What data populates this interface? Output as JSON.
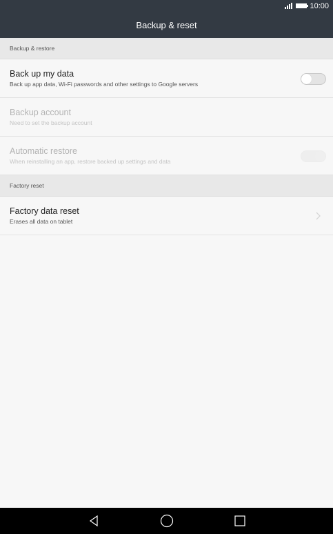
{
  "status_bar": {
    "time": "10:00",
    "signal_icon": "signal-icon",
    "battery_icon": "battery-icon"
  },
  "header": {
    "title": "Backup & reset"
  },
  "sections": [
    {
      "label": "Backup & restore",
      "items": [
        {
          "title": "Back up my data",
          "subtitle": "Back up app data, Wi-Fi passwords and other settings to Google servers",
          "control": "toggle",
          "toggle_on": false,
          "enabled": true
        },
        {
          "title": "Backup account",
          "subtitle": "Need to set the backup account",
          "control": "none",
          "enabled": false
        },
        {
          "title": "Automatic restore",
          "subtitle": "When reinstalling an app, restore backed up settings and data",
          "control": "toggle",
          "toggle_on": true,
          "enabled": false
        }
      ]
    },
    {
      "label": "Factory reset",
      "items": [
        {
          "title": "Factory data reset",
          "subtitle": "Erases all data on tablet",
          "control": "chevron",
          "enabled": true
        }
      ]
    }
  ],
  "nav_bar": {
    "back_icon": "back-triangle-icon",
    "home_icon": "home-circle-icon",
    "recent_icon": "recent-square-icon"
  },
  "colors": {
    "header_bg": "#333a43",
    "page_bg": "#f7f7f7",
    "section_bg": "#e8e8e8",
    "nav_bg": "#000000"
  }
}
